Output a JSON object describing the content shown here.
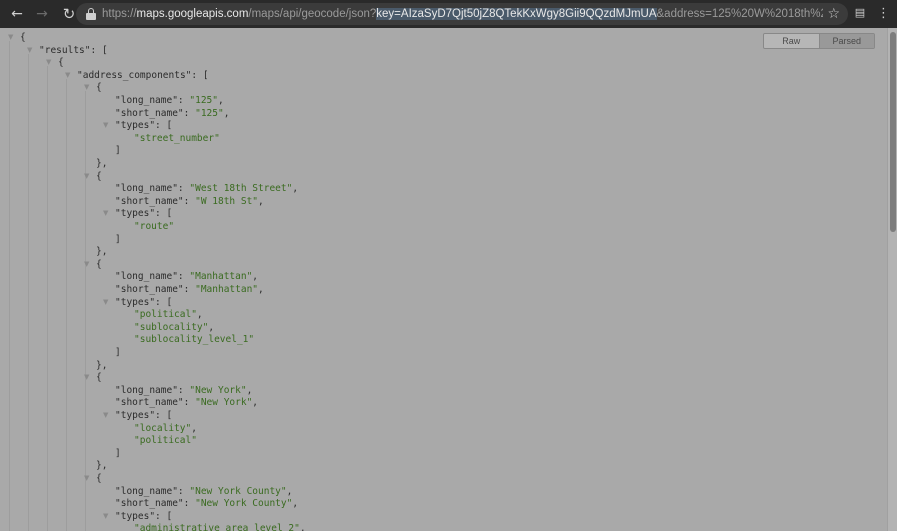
{
  "browser": {
    "url_scheme": "https://",
    "url_host": "maps.googleapis.com",
    "url_path": "/maps/api/geocode/json?",
    "url_selected": "key=AIzaSyD7Qjt50jZ8QTekKxWgy8Gii9QQzdMJmUA",
    "url_rest": "&address=125%20W%2018th%20St%2C%20New",
    "icons": {
      "back": "arrow-left-icon",
      "forward": "arrow-right-icon",
      "reload": "reload-icon",
      "lock": "lock-icon",
      "bookmark": "star-icon",
      "extension": "incognito-extension-icon",
      "menu": "kebab-menu-icon"
    }
  },
  "viewer": {
    "raw_label": "Raw",
    "parsed_label": "Parsed"
  },
  "json_lines": [
    "{",
    "\"results\": [",
    "{",
    "\"address_components\": [",
    "{",
    "\"long_name\": \"125\",",
    "\"short_name\": \"125\",",
    "\"types\": [",
    "\"street_number\"",
    "]",
    "},",
    "{",
    "\"long_name\": \"West 18th Street\",",
    "\"short_name\": \"W 18th St\",",
    "\"types\": [",
    "\"route\"",
    "]",
    "},",
    "{",
    "\"long_name\": \"Manhattan\",",
    "\"short_name\": \"Manhattan\",",
    "\"types\": [",
    "\"political\",",
    "\"sublocality\",",
    "\"sublocality_level_1\"",
    "]",
    "},",
    "{",
    "\"long_name\": \"New York\",",
    "\"short_name\": \"New York\",",
    "\"types\": [",
    "\"locality\",",
    "\"political\"",
    "]",
    "},",
    "{",
    "\"long_name\": \"New York County\",",
    "\"short_name\": \"New York County\",",
    "\"types\": [",
    "\"administrative_area_level_2\","
  ],
  "colors": {
    "overlay": "#a9a9a9",
    "toolbar": "#2a2a2a",
    "string": "#3a6b20"
  }
}
